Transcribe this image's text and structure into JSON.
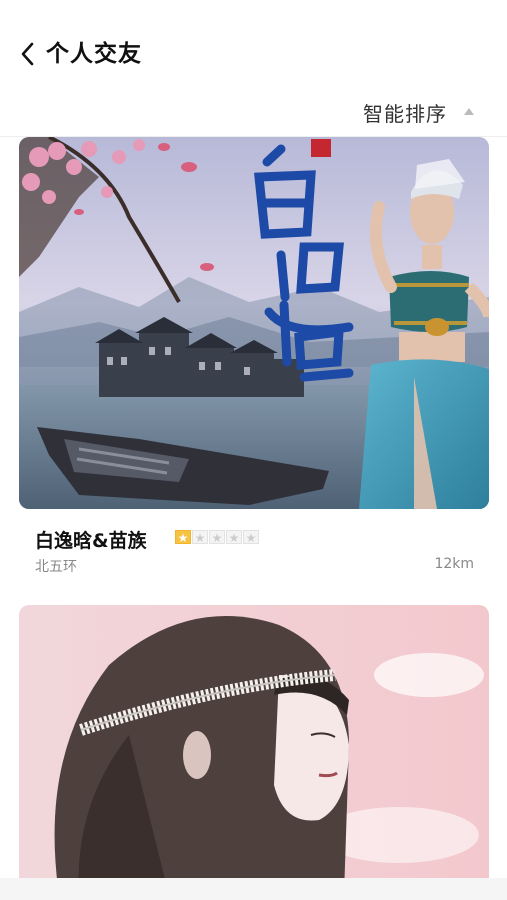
{
  "header": {
    "back_icon": "chevron-left-icon",
    "title": "个人交友"
  },
  "sort": {
    "label": "智能排序",
    "arrow_icon": "triangle-up-icon"
  },
  "cards": [
    {
      "name": "白逸晗&苗族",
      "rating": 1,
      "rating_max": 5,
      "location": "北五环",
      "distance": "12km",
      "image_text": "白逸晗"
    },
    {
      "name": "",
      "location": "",
      "distance": ""
    }
  ],
  "colors": {
    "star_on": "#f6c343",
    "star_off": "#f4f4f4",
    "secondary_text": "#888888"
  }
}
